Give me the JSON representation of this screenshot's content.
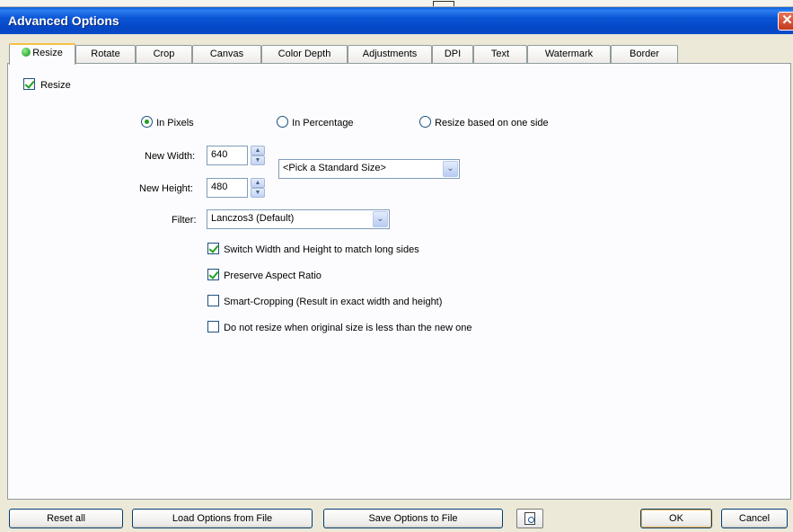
{
  "window": {
    "title": "Advanced Options"
  },
  "tabs": [
    {
      "label": "Resize",
      "active": true
    },
    {
      "label": "Rotate"
    },
    {
      "label": "Crop"
    },
    {
      "label": "Canvas"
    },
    {
      "label": "Color Depth"
    },
    {
      "label": "Adjustments"
    },
    {
      "label": "DPI"
    },
    {
      "label": "Text"
    },
    {
      "label": "Watermark"
    },
    {
      "label": "Border"
    }
  ],
  "resize": {
    "enable_label": "Resize",
    "enable_checked": true,
    "modes": [
      {
        "label": "In Pixels",
        "selected": true
      },
      {
        "label": "In Percentage",
        "selected": false
      },
      {
        "label": "Resize based on one side",
        "selected": false
      }
    ],
    "width_label": "New Width:",
    "width_value": "640",
    "height_label": "New Height:",
    "height_value": "480",
    "standard_size": "<Pick a Standard Size>",
    "filter_label": "Filter:",
    "filter_value": "Lanczos3 (Default)",
    "options": [
      {
        "label": "Switch Width and Height to match long sides",
        "checked": true
      },
      {
        "label": "Preserve Aspect Ratio",
        "checked": true
      },
      {
        "label": "Smart-Cropping (Result in exact width and height)",
        "checked": false
      },
      {
        "label": "Do not resize when original size is less than the new one",
        "checked": false
      }
    ]
  },
  "buttons": {
    "reset_all": "Reset all",
    "load_options": "Load Options from File",
    "save_options": "Save Options to File",
    "ok": "OK",
    "cancel": "Cancel"
  },
  "colors": {
    "titlebar": "#0a4bc7",
    "active_tab_accent": "#f5c046",
    "check_green": "#21a121"
  }
}
